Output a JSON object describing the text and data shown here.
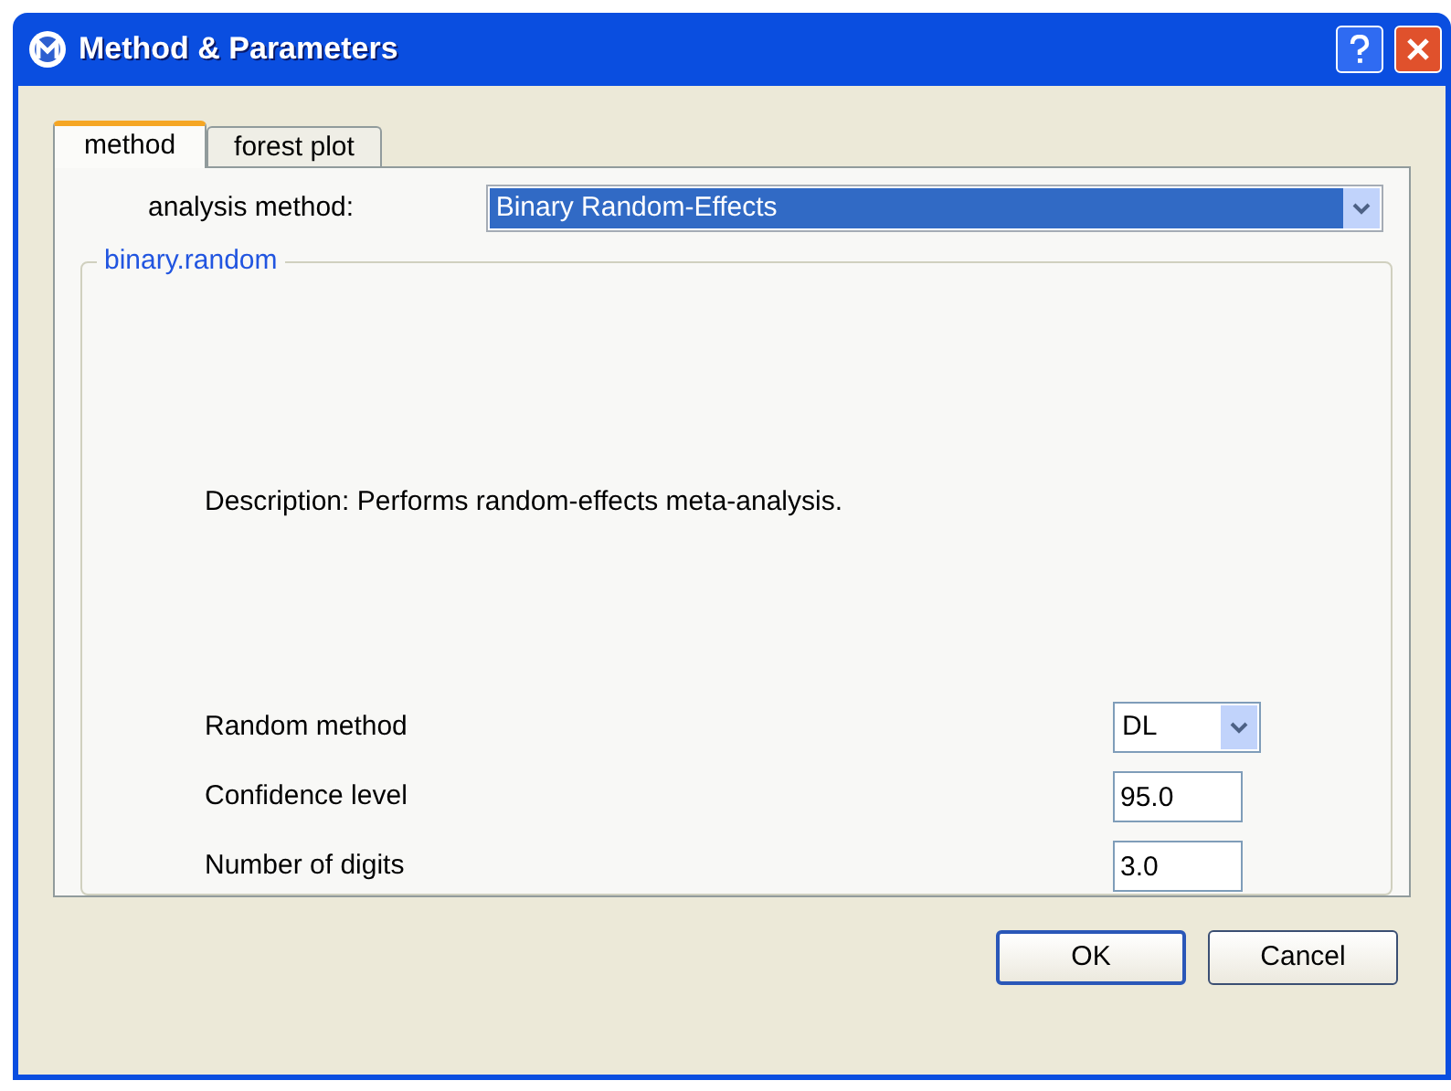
{
  "window": {
    "title": "Method & Parameters"
  },
  "tabs": [
    {
      "label": "method",
      "selected": true
    },
    {
      "label": "forest plot",
      "selected": false
    }
  ],
  "analysis_method": {
    "label": "analysis method:",
    "value": "Binary Random-Effects"
  },
  "group": {
    "title": "binary.random",
    "description": "Description: Performs random-effects meta-analysis.",
    "parameters": [
      {
        "label": "Random method",
        "kind": "select",
        "value": "DL"
      },
      {
        "label": "Confidence level",
        "kind": "text",
        "value": "95.0"
      },
      {
        "label": "Number of digits",
        "kind": "text",
        "value": "3.0"
      }
    ]
  },
  "buttons": [
    {
      "label": "OK",
      "default": true
    },
    {
      "label": "Cancel",
      "default": false
    }
  ]
}
